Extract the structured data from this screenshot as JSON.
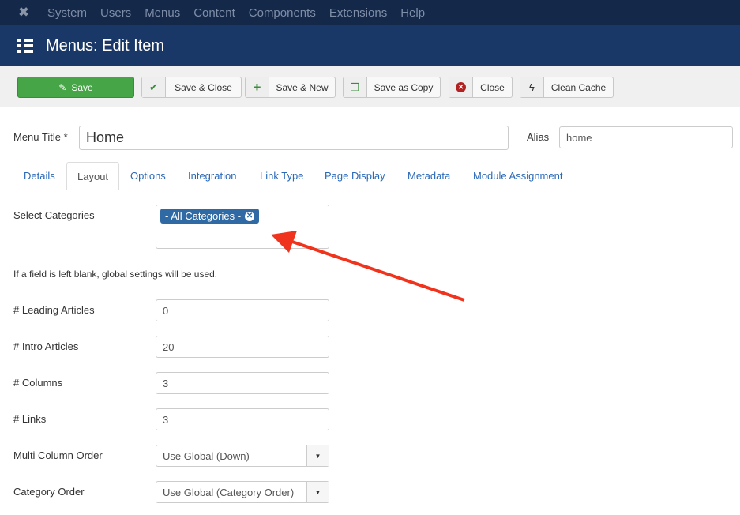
{
  "topnav": {
    "items": [
      "System",
      "Users",
      "Menus",
      "Content",
      "Components",
      "Extensions",
      "Help"
    ]
  },
  "header": {
    "title": "Menus: Edit Item"
  },
  "toolbar": {
    "save": "Save",
    "save_close": "Save & Close",
    "save_new": "Save & New",
    "save_copy": "Save as Copy",
    "close": "Close",
    "clean_cache": "Clean Cache"
  },
  "form": {
    "menu_title_label": "Menu Title *",
    "menu_title_value": "Home",
    "alias_label": "Alias",
    "alias_value": "home"
  },
  "tabs": [
    "Details",
    "Layout",
    "Options",
    "Integration",
    "Link Type",
    "Page Display",
    "Metadata",
    "Module Assignment"
  ],
  "layout": {
    "select_categories_label": "Select Categories",
    "category_chip": "- All Categories -",
    "note": "If a field is left blank, global settings will be used.",
    "fields": [
      {
        "label": "# Leading Articles",
        "value": "0"
      },
      {
        "label": "# Intro Articles",
        "value": "20"
      },
      {
        "label": "# Columns",
        "value": "3"
      },
      {
        "label": "# Links",
        "value": "3"
      },
      {
        "label": "Multi Column Order",
        "value": "Use Global (Down)"
      },
      {
        "label": "Category Order",
        "value": "Use Global (Category Order)"
      }
    ]
  },
  "colors": {
    "arrow": "#f0331c",
    "save": "#46a546",
    "header": "#1a3867"
  }
}
